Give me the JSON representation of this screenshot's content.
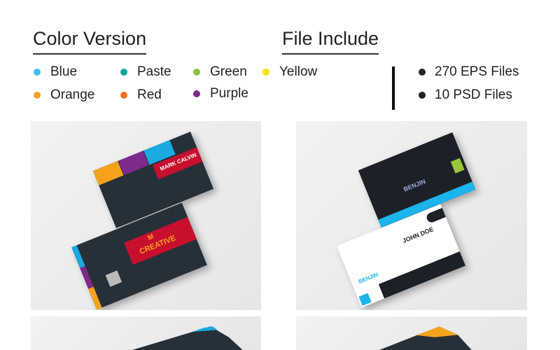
{
  "color_version": {
    "title": "Color Version",
    "colors": [
      {
        "label": "Blue",
        "color": "#3bbff0"
      },
      {
        "label": "Paste",
        "color": "#12a89a"
      },
      {
        "label": "Green",
        "color": "#8bc43f"
      },
      {
        "label": "Yellow",
        "color": "#f5e50a"
      },
      {
        "label": "Orange",
        "color": "#f6a21d"
      },
      {
        "label": "Red",
        "color": "#f07022"
      },
      {
        "label": "Purple",
        "color": "#7d2a8c"
      }
    ]
  },
  "file_include": {
    "title": "File Include",
    "files": [
      "270 EPS Files",
      "10 PSD Files"
    ]
  },
  "previews": {
    "creative": {
      "name": "MARK CALVIN",
      "brand": "CREATIVE",
      "logo": "M"
    },
    "benjin": {
      "name": "JOHN DOE",
      "brand": "BENJIN"
    }
  }
}
